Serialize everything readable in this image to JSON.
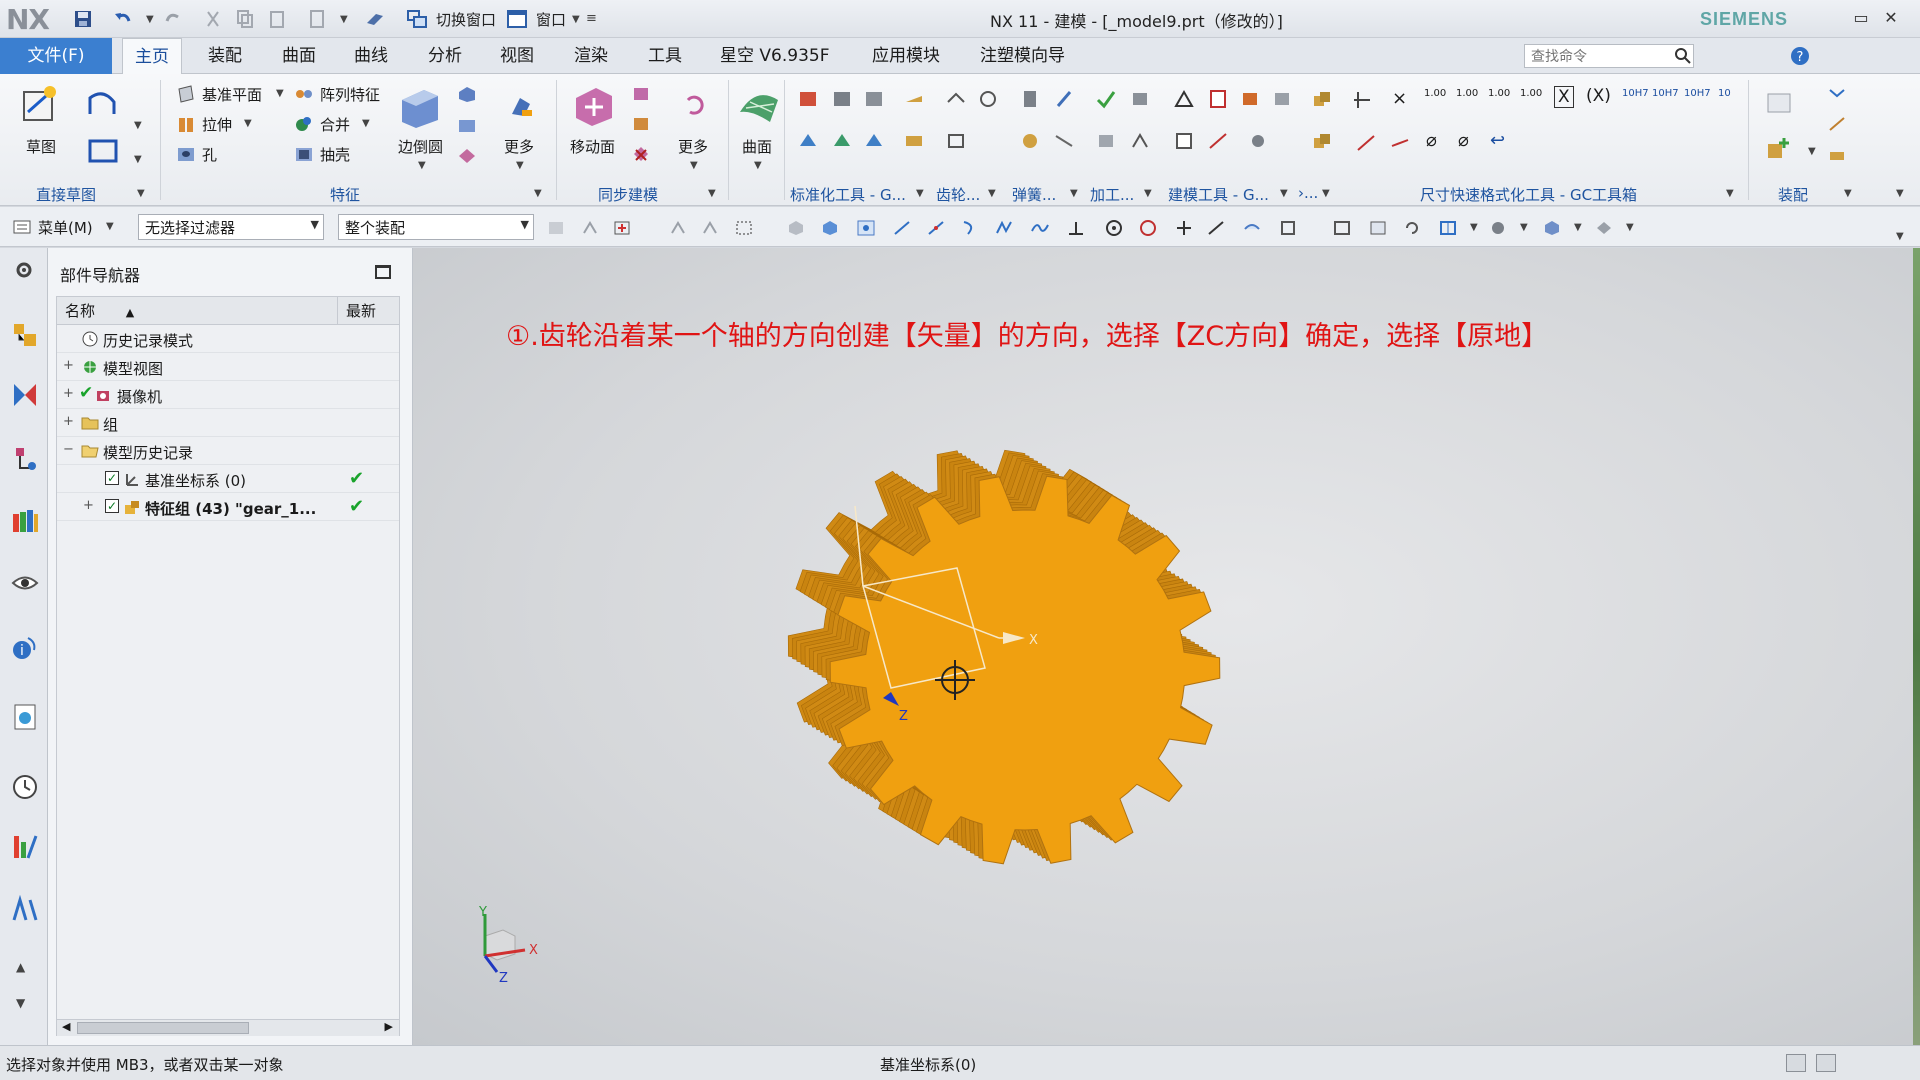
{
  "titlebar": {
    "logo": "NX",
    "switch_window": "切换窗口",
    "window": "窗口",
    "title": "NX 11 - 建模 - [_model9.prt（修改的）]",
    "brand": "SIEMENS"
  },
  "menu": {
    "file": "文件(F)",
    "tabs": [
      "主页",
      "装配",
      "曲面",
      "曲线",
      "分析",
      "视图",
      "渲染",
      "工具",
      "星空 V6.935F",
      "应用模块",
      "注塑模向导"
    ],
    "active_tab": "主页",
    "search_placeholder": "查找命令"
  },
  "ribbon": {
    "sketch": "草图",
    "datum_plane": "基准平面",
    "pattern_feature": "阵列特征",
    "extrude": "拉伸",
    "unite": "合并",
    "hole": "孔",
    "shell": "抽壳",
    "edge_blend": "边倒圆",
    "more": "更多",
    "move_face": "移动面",
    "surface": "曲面",
    "groups": {
      "direct_sketch": "直接草图",
      "feature": "特征",
      "sync_modeling": "同步建模",
      "std_tools": "标准化工具 - G...",
      "gear": "齿轮...",
      "spring": "弹簧...",
      "machining": "加工...",
      "modeling_tools": "建模工具 - G...",
      "more_group": "›...",
      "dim_tools": "尺寸快速格式化工具 - GC工具箱",
      "assembly": "装配"
    },
    "dim_buttons": [
      "1.00",
      "1.00",
      "1.00",
      "1.00",
      "10H7",
      "10H7",
      "10H7",
      "10"
    ]
  },
  "selection_bar": {
    "menu": "菜单(M)",
    "filter": "无选择过滤器",
    "scope": "整个装配"
  },
  "navigator": {
    "title": "部件导航器",
    "col_name": "名称",
    "col_latest": "最新",
    "rows": [
      {
        "label": "历史记录模式"
      },
      {
        "label": "模型视图"
      },
      {
        "label": "摄像机"
      },
      {
        "label": "组"
      },
      {
        "label": "模型历史记录"
      },
      {
        "label": "基准坐标系 (0)"
      },
      {
        "label": "特征组 (43) \"gear_1..."
      }
    ]
  },
  "viewport": {
    "annotation": "①.齿轮沿着某一个轴的方向创建【矢量】的方向，选择【ZC方向】确定，选择【原地】",
    "axis_x": "X",
    "axis_y": "Y",
    "axis_z": "Z",
    "gear_color": "#f0a010",
    "tooth_count": 18
  },
  "status": {
    "prompt": "选择对象并使用 MB3，或者双击某一对象",
    "selection": "基准坐标系(0)"
  }
}
